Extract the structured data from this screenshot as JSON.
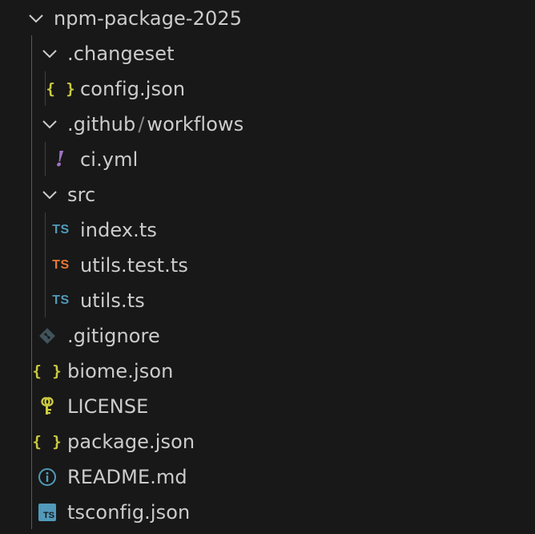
{
  "explorer": {
    "root": {
      "label": "npm-package-2025",
      "expanded": true,
      "icon": "chevron-down-icon"
    },
    "changeset": {
      "label": ".changeset",
      "expanded": true,
      "icon": "chevron-down-icon"
    },
    "changeset_config": {
      "label": "config.json",
      "icon": "json-icon",
      "icon_glyph": "{ }"
    },
    "github": {
      "segment1": ".github",
      "separator": "/",
      "segment2": "workflows",
      "expanded": true,
      "icon": "chevron-down-icon"
    },
    "ci": {
      "label": "ci.yml",
      "icon": "yaml-icon",
      "icon_glyph": "!"
    },
    "src": {
      "label": "src",
      "expanded": true,
      "icon": "chevron-down-icon"
    },
    "index_ts": {
      "label": "index.ts",
      "icon": "typescript-icon",
      "icon_glyph": "TS"
    },
    "utils_test_ts": {
      "label": "utils.test.ts",
      "icon": "typescript-test-icon",
      "icon_glyph": "TS"
    },
    "utils_ts": {
      "label": "utils.ts",
      "icon": "typescript-icon",
      "icon_glyph": "TS"
    },
    "gitignore": {
      "label": ".gitignore",
      "icon": "git-icon"
    },
    "biome_json": {
      "label": "biome.json",
      "icon": "json-icon",
      "icon_glyph": "{ }"
    },
    "license": {
      "label": "LICENSE",
      "icon": "license-key-icon"
    },
    "package_json": {
      "label": "package.json",
      "icon": "json-icon",
      "icon_glyph": "{ }"
    },
    "readme": {
      "label": "README.md",
      "icon": "info-icon"
    },
    "tsconfig": {
      "label": "tsconfig.json",
      "icon": "tsconfig-icon",
      "icon_glyph": "TS"
    }
  },
  "colors": {
    "background": "#181818",
    "text": "#cccccc",
    "json": "#cbcb41",
    "typescript": "#519aba",
    "typescript_test": "#e37933",
    "yaml": "#a074c4",
    "git": "#41535b",
    "info": "#519aba",
    "license": "#cbcb41"
  }
}
